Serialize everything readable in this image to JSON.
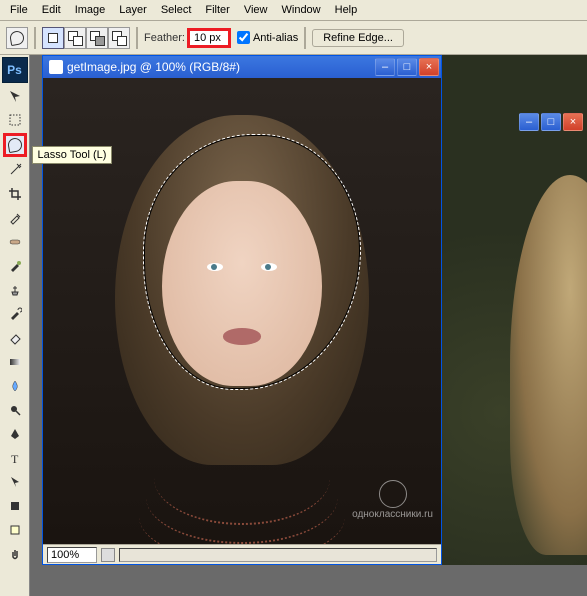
{
  "menu": {
    "file": "File",
    "edit": "Edit",
    "image": "Image",
    "layer": "Layer",
    "select": "Select",
    "filter": "Filter",
    "view": "View",
    "window": "Window",
    "help": "Help"
  },
  "options": {
    "feather_label": "Feather:",
    "feather_value": "10 px",
    "antialias_label": "Anti-alias",
    "refine_edge": "Refine Edge..."
  },
  "tooltip": {
    "lasso": "Lasso Tool (L)"
  },
  "document": {
    "title": "getImage.jpg @ 100% (RGB/8#)",
    "zoom": "100%",
    "watermark": "одноклассники.ru"
  },
  "app": {
    "badge": "Ps"
  },
  "winbtns": {
    "min": "–",
    "max": "□",
    "close": "×"
  }
}
